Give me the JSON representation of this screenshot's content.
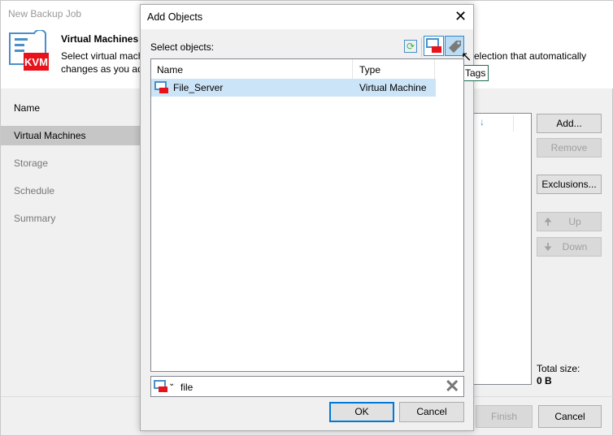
{
  "wizard": {
    "title": "New Backup Job",
    "header_title": "Virtual Machines",
    "desc_line1_left": "Select virtual mach",
    "desc_line1_right": "election that automatically",
    "desc_line2": "changes as you ad",
    "logo_text": "KVM",
    "nav": [
      "Name",
      "Virtual Machines",
      "Storage",
      "Schedule",
      "Summary"
    ],
    "selected_nav": 1,
    "buttons": {
      "add": "Add...",
      "remove": "Remove",
      "exclusions": "Exclusions...",
      "up": "Up",
      "down": "Down",
      "finish": "Finish",
      "cancel": "Cancel"
    },
    "total_size_label": "Total size:",
    "total_size_value": "0 B"
  },
  "dialog": {
    "title": "Add Objects",
    "select_label": "Select objects:",
    "tooltip": "Tags",
    "columns": [
      "Name",
      "Type"
    ],
    "rows": [
      {
        "name": "File_Server",
        "type": "Virtual Machine"
      }
    ],
    "search_value": "file",
    "ok": "OK",
    "cancel": "Cancel"
  },
  "colors": {
    "kvm_red": "#e8121b",
    "selection": "#cce4f7",
    "accent": "#0078d7"
  }
}
